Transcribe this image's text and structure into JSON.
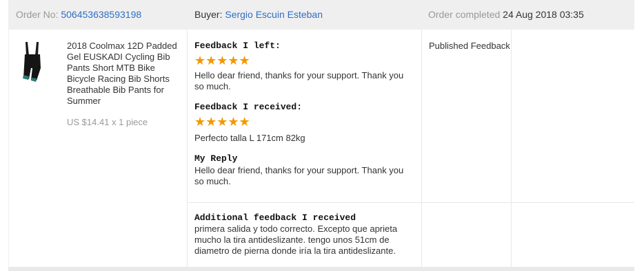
{
  "order": {
    "number_label": "Order No:",
    "number": "506453638593198",
    "buyer_label": "Buyer:",
    "buyer": "Sergio Escuin Esteban",
    "status_label": "Order completed",
    "completed_at": "24 Aug 2018 03:35"
  },
  "product": {
    "title": "2018 Coolmax 12D Padded Gel EUSKADI Cycling Bib Pants Short MTB Bike Bicycle Racing Bib Shorts Breathable Bib Pants for Summer",
    "price": "US $14.41 x 1 piece",
    "thumbnail_icon": "bib-shorts-thumbnail"
  },
  "feedback": {
    "left_title": "Feedback I left:",
    "left_rating": 5,
    "left_stars": "★★★★★",
    "left_text": "Hello dear friend, thanks for your support. Thank you so much.",
    "received_title": "Feedback I received:",
    "received_rating": 5,
    "received_stars": "★★★★★",
    "received_text": "Perfecto talla L 171cm 82kg",
    "reply_title": "My Reply",
    "reply_text": "Hello dear friend, thanks for your support. Thank you so much.",
    "additional_title": "Additional feedback I received",
    "additional_text": "primera salida y todo correcto. Excepto que aprieta mucho la tira antideslizante. tengo unos 51cm de diametro de pierna donde iría la tira antideslizante."
  },
  "status": {
    "text": "Published Feedback"
  },
  "colors": {
    "star": "#f39800",
    "link": "#2f6ec7",
    "header_bg": "#efefef"
  }
}
